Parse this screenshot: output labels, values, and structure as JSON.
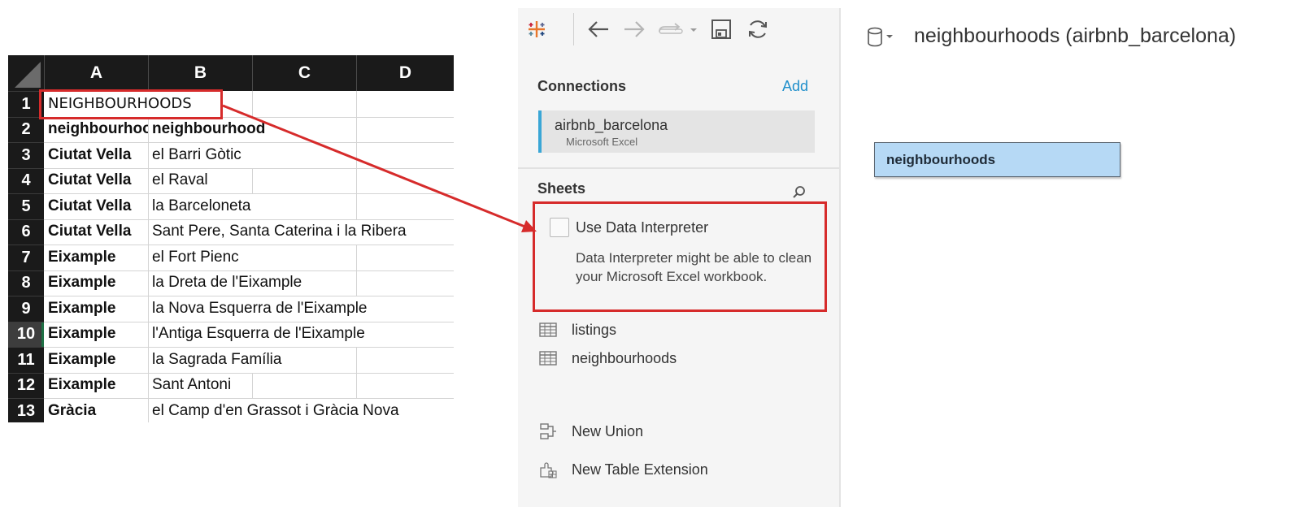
{
  "spreadsheet": {
    "columns": [
      "A",
      "B",
      "C",
      "D"
    ],
    "rows": [
      {
        "num": "1",
        "a": "NEIGHBOURHOODS",
        "b": ""
      },
      {
        "num": "2",
        "a": "neighbourhood_group",
        "b": "neighbourhood"
      },
      {
        "num": "3",
        "a": "Ciutat Vella",
        "b": "el Barri Gòtic"
      },
      {
        "num": "4",
        "a": "Ciutat Vella",
        "b": "el Raval"
      },
      {
        "num": "5",
        "a": "Ciutat Vella",
        "b": "la Barceloneta"
      },
      {
        "num": "6",
        "a": "Ciutat Vella",
        "b": "Sant Pere, Santa Caterina i la Ribera"
      },
      {
        "num": "7",
        "a": "Eixample",
        "b": "el Fort Pienc"
      },
      {
        "num": "8",
        "a": "Eixample",
        "b": "la Dreta de l'Eixample"
      },
      {
        "num": "9",
        "a": "Eixample",
        "b": "la Nova Esquerra de l'Eixample"
      },
      {
        "num": "10",
        "a": "Eixample",
        "b": "l'Antiga Esquerra de l'Eixample"
      },
      {
        "num": "11",
        "a": "Eixample",
        "b": "la Sagrada Família"
      },
      {
        "num": "12",
        "a": "Eixample",
        "b": "Sant Antoni"
      },
      {
        "num": "13",
        "a": "Gràcia",
        "b": "el Camp d'en Grassot i Gràcia Nova"
      }
    ]
  },
  "pane": {
    "connections_title": "Connections",
    "add_label": "Add",
    "connection": {
      "name": "airbnb_barcelona",
      "type": "Microsoft Excel"
    },
    "sheets_title": "Sheets",
    "interpreter": {
      "label": "Use Data Interpreter",
      "description": "Data Interpreter might be able to clean your Microsoft Excel workbook."
    },
    "sheets": [
      "listings",
      "neighbourhoods"
    ],
    "actions": [
      "New Union",
      "New Table Extension"
    ]
  },
  "canvas": {
    "datasource_title": "neighbourhoods (airbnb_barcelona)",
    "table_label": "neighbourhoods"
  },
  "colors": {
    "highlight": "#d62b2b",
    "accent": "#1f8fcb",
    "pill": "#b6d9f5"
  }
}
